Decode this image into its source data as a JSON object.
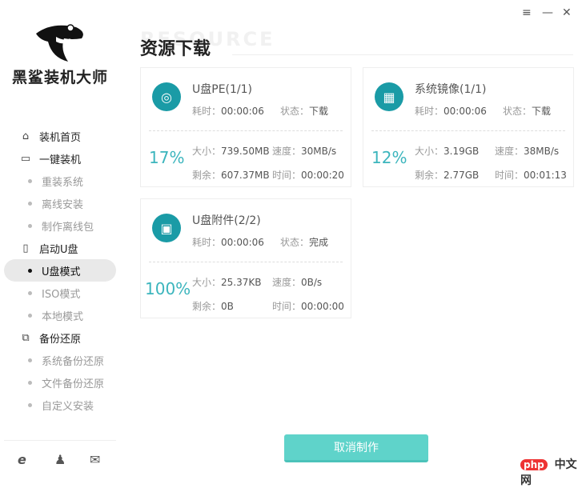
{
  "window": {
    "menu_icon": "≡",
    "min_icon": "—",
    "close_icon": "✕"
  },
  "brand": {
    "name": "黑鲨装机大师"
  },
  "sidebar": {
    "items": [
      {
        "label": "装机首页",
        "icon": "⌂",
        "type": "main"
      },
      {
        "label": "一键装机",
        "icon": "▭",
        "type": "main"
      },
      {
        "label": "重装系统",
        "type": "sub"
      },
      {
        "label": "离线安装",
        "type": "sub"
      },
      {
        "label": "制作离线包",
        "type": "sub"
      },
      {
        "label": "启动U盘",
        "icon": "▯",
        "type": "main"
      },
      {
        "label": "U盘模式",
        "type": "sub",
        "active": true
      },
      {
        "label": "ISO模式",
        "type": "sub"
      },
      {
        "label": "本地模式",
        "type": "sub"
      },
      {
        "label": "备份还原",
        "icon": "⧉",
        "type": "main"
      },
      {
        "label": "系统备份还原",
        "type": "sub"
      },
      {
        "label": "文件备份还原",
        "type": "sub"
      },
      {
        "label": "自定义安装",
        "type": "sub"
      }
    ],
    "footer_icons": [
      "e",
      "♟",
      "✉"
    ]
  },
  "page": {
    "watermark": "RESOURCE",
    "title": "资源下载"
  },
  "cards": [
    {
      "name": "U盘PE(1/1)",
      "icon": "◎",
      "elapsed_label": "耗时：",
      "elapsed": "00:00:06",
      "status_label": "状态：",
      "status": "下载",
      "percent": "17%",
      "size_label": "大小：",
      "size": "739.50MB",
      "speed_label": "速度：",
      "speed": "30MB/s",
      "remain_label": "剩余：",
      "remain": "607.37MB",
      "time_label": "时间：",
      "time": "00:00:20"
    },
    {
      "name": "系统镜像(1/1)",
      "icon": "▦",
      "elapsed_label": "耗时：",
      "elapsed": "00:00:06",
      "status_label": "状态：",
      "status": "下载",
      "percent": "12%",
      "size_label": "大小：",
      "size": "3.19GB",
      "speed_label": "速度：",
      "speed": "38MB/s",
      "remain_label": "剩余：",
      "remain": "2.77GB",
      "time_label": "时间：",
      "time": "00:01:13"
    },
    {
      "name": "U盘附件(2/2)",
      "icon": "▣",
      "elapsed_label": "耗时：",
      "elapsed": "00:00:06",
      "status_label": "状态：",
      "status": "完成",
      "percent": "100%",
      "size_label": "大小：",
      "size": "25.37KB",
      "speed_label": "速度：",
      "speed": "0B/s",
      "remain_label": "剩余：",
      "remain": "0B",
      "time_label": "时间：",
      "time": "00:00:00"
    }
  ],
  "cancel_button": "取消制作",
  "watermark_site": {
    "badge": "php",
    "text": "中文网"
  }
}
